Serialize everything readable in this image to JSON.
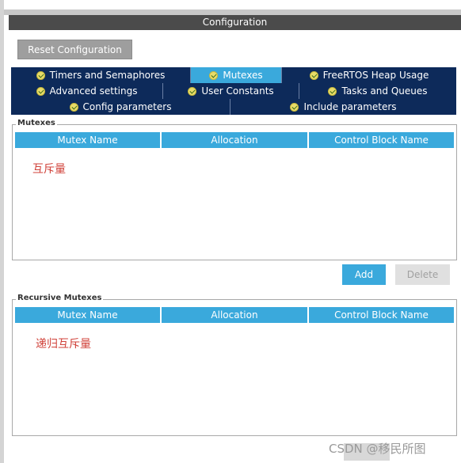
{
  "header": {
    "title": "Configuration"
  },
  "toolbar": {
    "reset_label": "Reset Configuration"
  },
  "tabs": {
    "row1": [
      {
        "label": "Timers and Semaphores",
        "active": false
      },
      {
        "label": "Mutexes",
        "active": true
      },
      {
        "label": "FreeRTOS Heap Usage",
        "active": false
      }
    ],
    "row2": [
      {
        "label": "Advanced settings",
        "active": false
      },
      {
        "label": "User Constants",
        "active": false
      },
      {
        "label": "Tasks and Queues",
        "active": false
      }
    ],
    "row3": [
      {
        "label": "Config parameters",
        "active": false
      },
      {
        "label": "Include parameters",
        "active": false
      }
    ]
  },
  "mutexes": {
    "title": "Mutexes",
    "columns": [
      "Mutex Name",
      "Allocation",
      "Control Block Name"
    ],
    "note": "互斥量"
  },
  "actions": {
    "add_label": "Add",
    "delete_label": "Delete"
  },
  "recursive": {
    "title": "Recursive Mutexes",
    "columns": [
      "Mutex Name",
      "Allocation",
      "Control Block Name"
    ],
    "note": "递归互斥量"
  },
  "watermark": "CSDN @移民所图",
  "colors": {
    "accent": "#3aa9dc",
    "tab_dark": "#0d2a5a",
    "note_red": "#d0423a"
  }
}
